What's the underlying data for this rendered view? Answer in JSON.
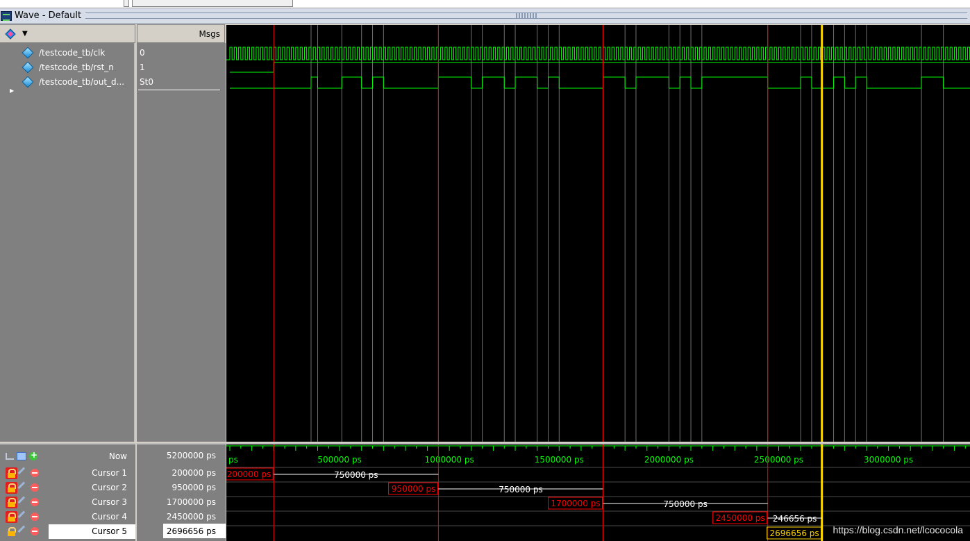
{
  "window": {
    "title": "Wave - Default"
  },
  "header": {
    "msgs_label": "Msgs"
  },
  "signals": [
    {
      "name": "/testcode_tb/clk",
      "value": "0"
    },
    {
      "name": "/testcode_tb/rst_n",
      "value": "1"
    },
    {
      "name": "/testcode_tb/out_d...",
      "value": "St0"
    }
  ],
  "now": {
    "label": "Now",
    "value": "5200000 ps"
  },
  "cursors": [
    {
      "label": "Cursor 1",
      "value": "200000 ps",
      "time": 200000,
      "locked": true
    },
    {
      "label": "Cursor 2",
      "value": "950000 ps",
      "time": 950000,
      "locked": true
    },
    {
      "label": "Cursor 3",
      "value": "1700000 ps",
      "time": 1700000,
      "locked": true
    },
    {
      "label": "Cursor 4",
      "value": "2450000 ps",
      "time": 2450000,
      "locked": true
    },
    {
      "label": "Cursor 5",
      "value": "2696656 ps",
      "time": 2696656,
      "locked": false,
      "active": true
    }
  ],
  "deltas": [
    "750000 ps",
    "750000 ps",
    "750000 ps",
    "246656 ps"
  ],
  "timeline": {
    "start_label": "ps",
    "ticks": [
      {
        "t": 500000,
        "label": "500000 ps"
      },
      {
        "t": 1000000,
        "label": "1000000 ps"
      },
      {
        "t": 1500000,
        "label": "1500000 ps"
      },
      {
        "t": 2000000,
        "label": "2000000 ps"
      },
      {
        "t": 2500000,
        "label": "2500000 ps"
      },
      {
        "t": 3000000,
        "label": "3000000 ps"
      }
    ]
  },
  "waves": {
    "clk_period": 20000,
    "rst_release": 200000,
    "out_edges": [
      370000,
      400000,
      510000,
      600000,
      650000,
      700000,
      950000,
      1100000,
      1150000,
      1250000,
      1300000,
      1400000,
      1450000,
      1500000,
      1700000,
      1800000,
      1850000,
      2000000,
      2050000,
      2100000,
      2150000,
      2450000,
      2600000,
      2650000,
      2750000,
      2800000,
      2850000,
      2900000,
      3150000,
      3250000
    ]
  },
  "colors": {
    "wave": "#00ff00",
    "cursor_locked": "#ff0000",
    "cursor_active": "#ffd700",
    "grid": "#a0a0a0"
  },
  "watermark": "https://blog.csdn.net/lcococola"
}
